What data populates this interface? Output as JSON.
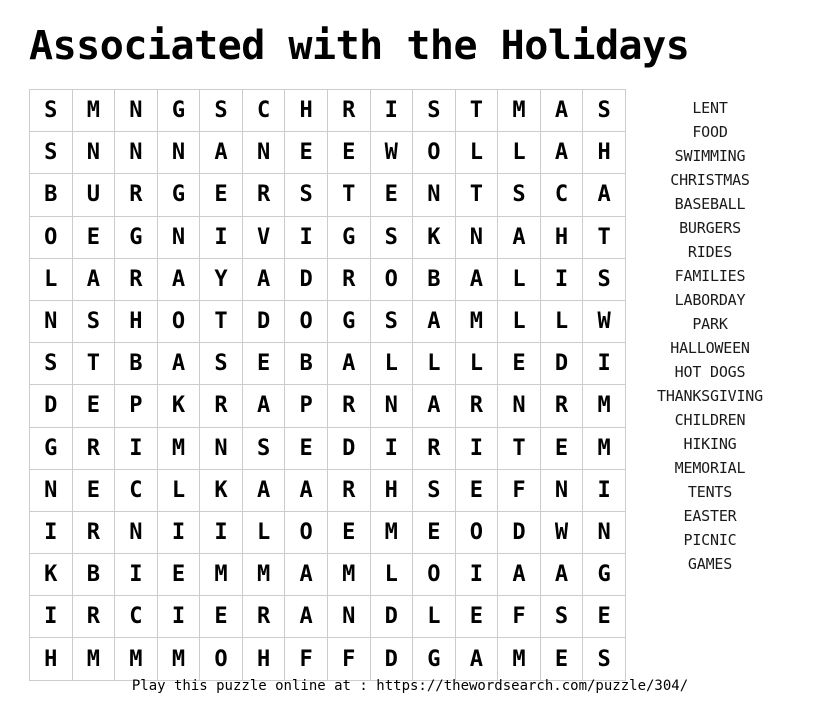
{
  "page": {
    "title": "Associated with the Holidays",
    "background_color": "#ffffff",
    "text_color": "#000000",
    "grid_border_color": "#cccccc"
  },
  "grid": {
    "columns": 14,
    "rows_count": 14,
    "rows": [
      [
        "S",
        "M",
        "N",
        "G",
        "S",
        "C",
        "H",
        "R",
        "I",
        "S",
        "T",
        "M",
        "A",
        "S"
      ],
      [
        "S",
        "N",
        "N",
        "N",
        "A",
        "N",
        "E",
        "E",
        "W",
        "O",
        "L",
        "L",
        "A",
        "H"
      ],
      [
        "B",
        "U",
        "R",
        "G",
        "E",
        "R",
        "S",
        "T",
        "E",
        "N",
        "T",
        "S",
        "C",
        "A"
      ],
      [
        "O",
        "E",
        "G",
        "N",
        "I",
        "V",
        "I",
        "G",
        "S",
        "K",
        "N",
        "A",
        "H",
        "T"
      ],
      [
        "L",
        "A",
        "R",
        "A",
        "Y",
        "A",
        "D",
        "R",
        "O",
        "B",
        "A",
        "L",
        "I",
        "S"
      ],
      [
        "N",
        "S",
        "H",
        "O",
        "T",
        "D",
        "O",
        "G",
        "S",
        "A",
        "M",
        "L",
        "L",
        "W"
      ],
      [
        "S",
        "T",
        "B",
        "A",
        "S",
        "E",
        "B",
        "A",
        "L",
        "L",
        "L",
        "E",
        "D",
        "I"
      ],
      [
        "D",
        "E",
        "P",
        "K",
        "R",
        "A",
        "P",
        "R",
        "N",
        "A",
        "R",
        "N",
        "R",
        "M"
      ],
      [
        "G",
        "R",
        "I",
        "M",
        "N",
        "S",
        "E",
        "D",
        "I",
        "R",
        "I",
        "T",
        "E",
        "M"
      ],
      [
        "N",
        "E",
        "C",
        "L",
        "K",
        "A",
        "A",
        "R",
        "H",
        "S",
        "E",
        "F",
        "N",
        "I"
      ],
      [
        "I",
        "R",
        "N",
        "I",
        "I",
        "L",
        "O",
        "E",
        "M",
        "E",
        "O",
        "D",
        "W",
        "N"
      ],
      [
        "K",
        "B",
        "I",
        "E",
        "M",
        "M",
        "A",
        "M",
        "L",
        "O",
        "I",
        "A",
        "A",
        "G"
      ],
      [
        "I",
        "R",
        "C",
        "I",
        "E",
        "R",
        "A",
        "N",
        "D",
        "L",
        "E",
        "F",
        "S",
        "E"
      ],
      [
        "H",
        "M",
        "M",
        "M",
        "O",
        "H",
        "F",
        "F",
        "D",
        "G",
        "A",
        "M",
        "E",
        "S"
      ]
    ]
  },
  "word_list": {
    "words": [
      "LENT",
      "FOOD",
      "SWIMMING",
      "CHRISTMAS",
      "BASEBALL",
      "BURGERS",
      "RIDES",
      "FAMILIES",
      "LABORDAY",
      "PARK",
      "HALLOWEEN",
      "HOT DOGS",
      "THANKSGIVING",
      "CHILDREN",
      "HIKING",
      "MEMORIAL",
      "TENTS",
      "EASTER",
      "PICNIC",
      "GAMES"
    ]
  },
  "footer": {
    "text": "Play this puzzle online at : https://thewordsearch.com/puzzle/304/"
  }
}
